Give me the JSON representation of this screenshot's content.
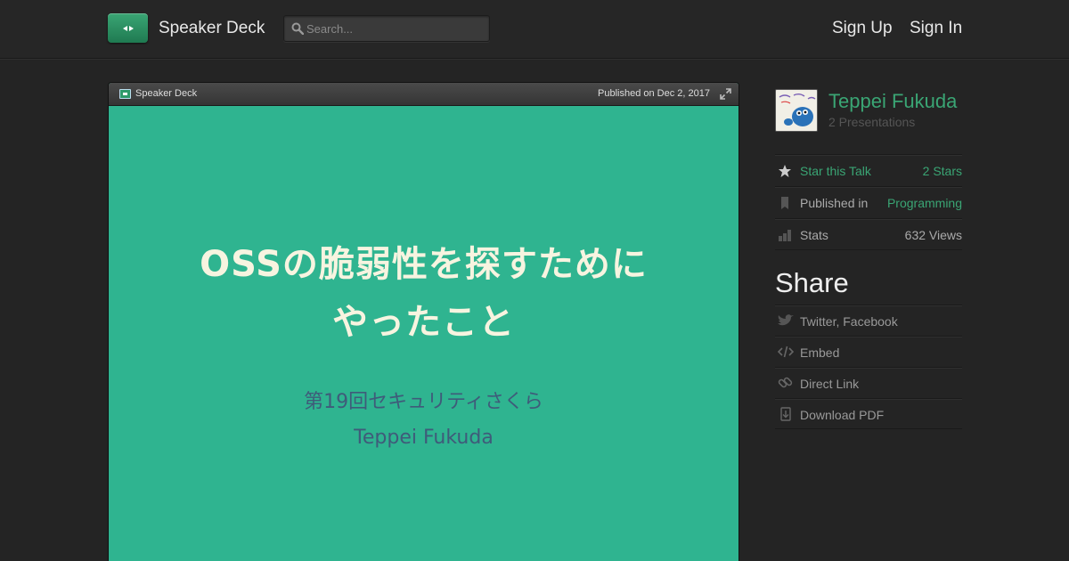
{
  "header": {
    "brand": "Speaker Deck",
    "search_placeholder": "Search...",
    "sign_up": "Sign Up",
    "sign_in": "Sign In"
  },
  "player": {
    "brand": "Speaker Deck",
    "published": "Published on Dec 2, 2017",
    "slide": {
      "title_line1": "OSSの脆弱性を探すために",
      "title_line2": "やったこと",
      "event": "第19回セキュリティさくら",
      "author": "Teppei Fukuda"
    }
  },
  "sidebar": {
    "author_name": "Teppei Fukuda",
    "presentation_count": "2 Presentations",
    "stats": [
      {
        "label": "Star this Talk",
        "value": "2 Stars",
        "icon": "star-icon"
      },
      {
        "label": "Published in",
        "value": "Programming",
        "icon": "bookmark-icon"
      },
      {
        "label": "Stats",
        "value": "632 Views",
        "icon": "bar-chart-icon"
      }
    ],
    "share_title": "Share",
    "share_items": [
      {
        "label": "Twitter, Facebook",
        "icon": "bird-icon"
      },
      {
        "label": "Embed",
        "icon": "code-icon"
      },
      {
        "label": "Direct Link",
        "icon": "link-icon"
      },
      {
        "label": "Download PDF",
        "icon": "download-icon"
      }
    ]
  },
  "colors": {
    "accent": "#3aa574",
    "slide_bg": "#2fb490",
    "slide_title": "#f7f4e0",
    "slide_sub": "#3f5b7a",
    "page_bg": "#242424"
  }
}
